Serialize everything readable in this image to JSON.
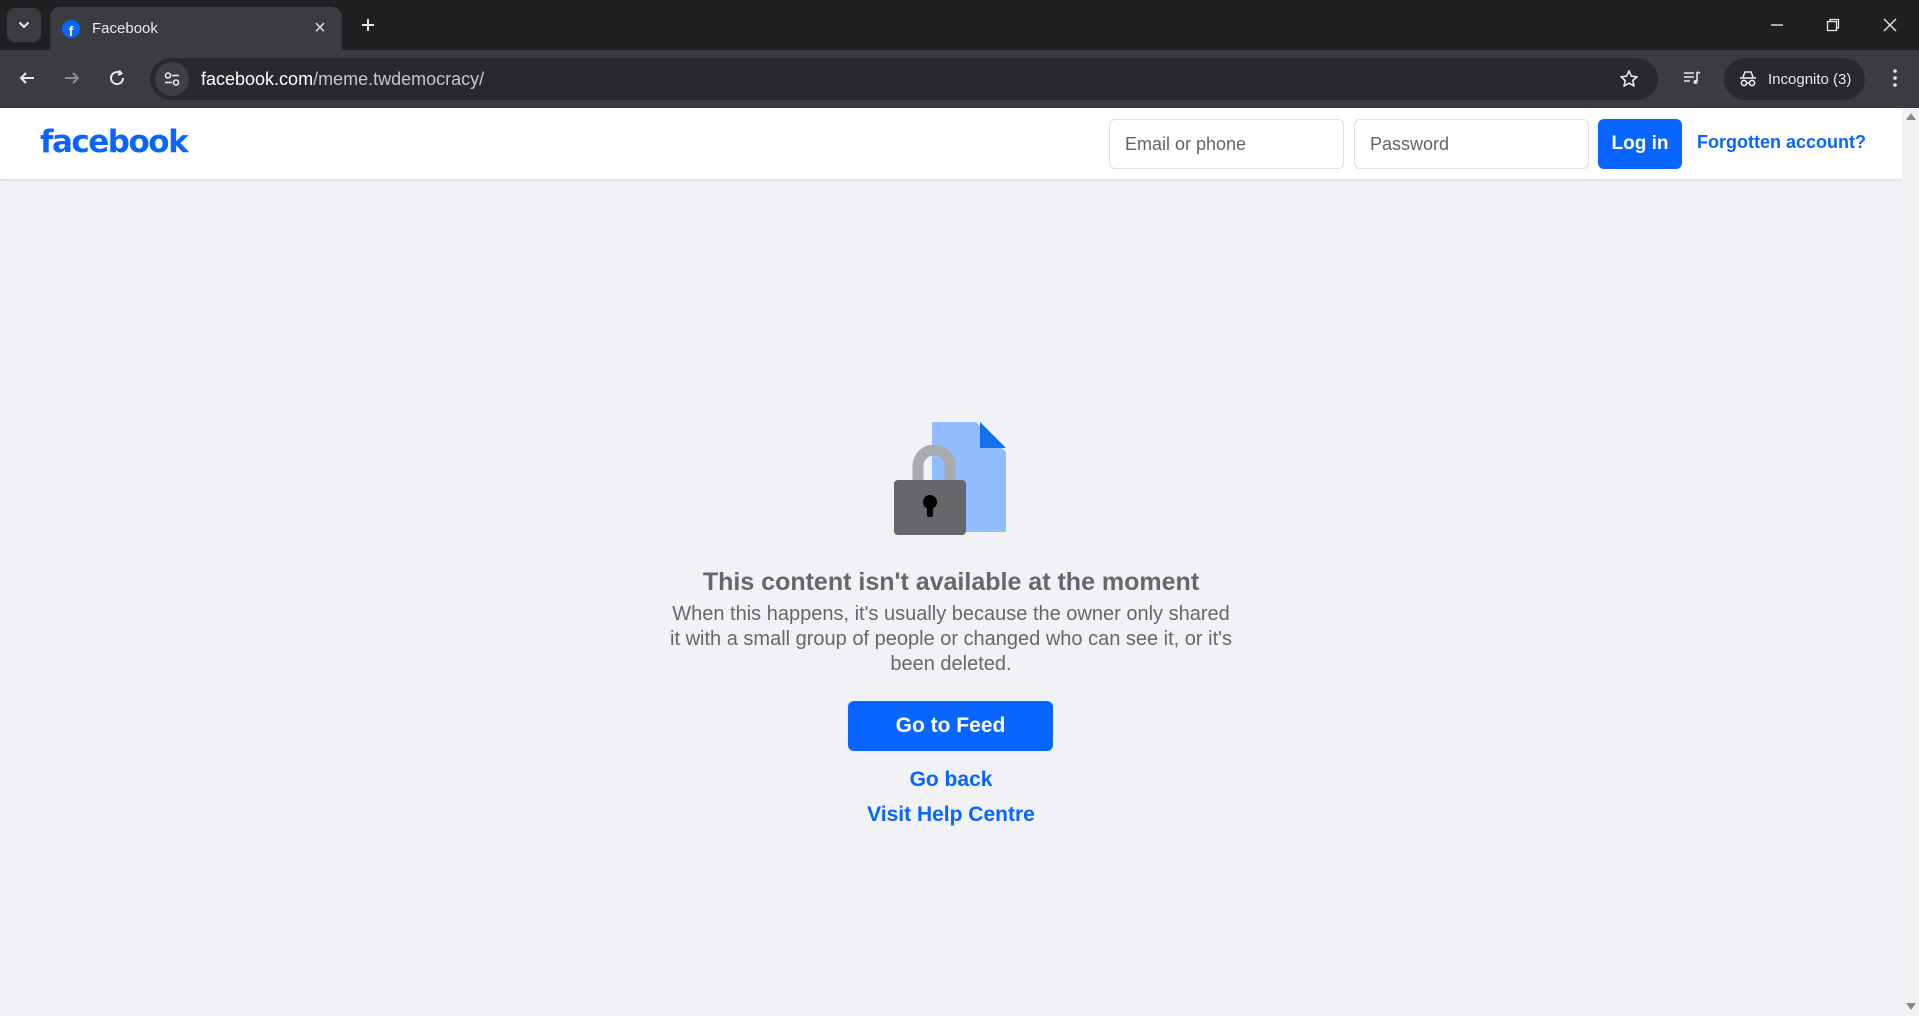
{
  "browser": {
    "tab_title": "Facebook",
    "url_host": "facebook.com",
    "url_path": "/meme.twdemocracy/",
    "incognito_label": "Incognito (3)"
  },
  "header": {
    "logo_text": "facebook",
    "email_placeholder": "Email or phone",
    "password_placeholder": "Password",
    "login_label": "Log in",
    "forgot_label": "Forgotten account?"
  },
  "main": {
    "headline": "This content isn't available at the moment",
    "description": "When this happens, it's usually because the owner only shared it with a small group of people or changed who can see it, or it's been deleted.",
    "feed_button": "Go to Feed",
    "back_link": "Go back",
    "help_link": "Visit Help Centre"
  },
  "colors": {
    "brand_blue": "#0866ff",
    "page_bg": "#f0f2f5",
    "muted_text": "#65676b"
  },
  "icons": [
    "tab-search-icon",
    "facebook-favicon",
    "close-icon",
    "plus-icon",
    "minimize-icon",
    "restore-icon",
    "back-arrow-icon",
    "forward-arrow-icon",
    "reload-icon",
    "site-settings-icon",
    "star-icon",
    "media-queue-icon",
    "incognito-icon",
    "more-vert-icon",
    "lock-document-icon"
  ]
}
